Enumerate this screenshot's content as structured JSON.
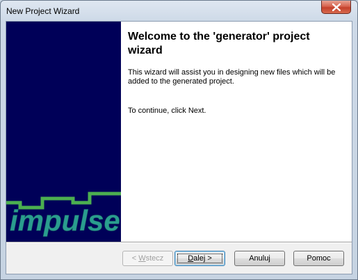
{
  "window": {
    "title": "New Project Wizard"
  },
  "content": {
    "heading": "Welcome to the 'generator' project wizard",
    "description": "This wizard will assist you in designing new files which will be added to the generated project.",
    "continue_text": "To continue, click Next."
  },
  "logo": {
    "text": "impulse",
    "color": "#2a9d8f",
    "line_color": "#4caf50"
  },
  "buttons": {
    "back": {
      "prefix": "< ",
      "mnemonic": "W",
      "rest": "stecz",
      "enabled": false
    },
    "next": {
      "mnemonic": "D",
      "rest": "alej >",
      "default": true
    },
    "cancel": {
      "label": "Anuluj"
    },
    "help": {
      "label": "Pomoc"
    }
  },
  "colors": {
    "side_panel": "#000058",
    "content_bg": "#ffffff",
    "dialog_bg": "#f0f0f0"
  }
}
